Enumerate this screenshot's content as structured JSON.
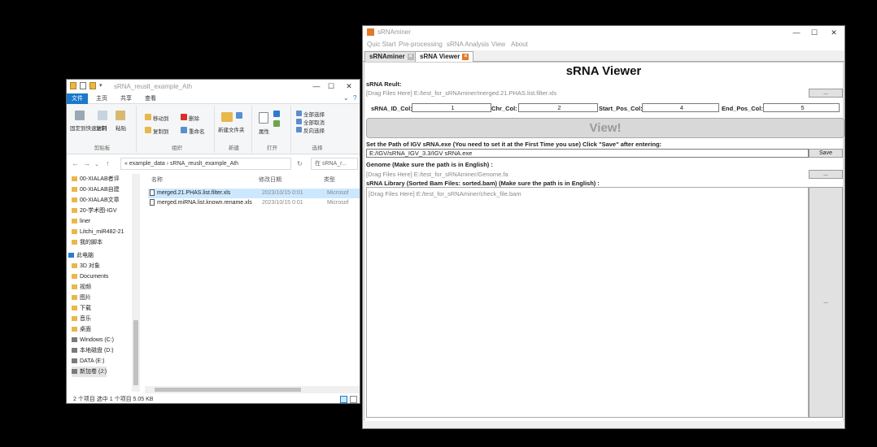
{
  "explorer": {
    "title": "sRNA_reuslt_example_Ath",
    "tabs": [
      "文件",
      "主页",
      "共享",
      "查看"
    ],
    "ribbon": {
      "groups": [
        {
          "label": "剪贴板",
          "items": [
            "固定到快速访问",
            "复制",
            "粘贴"
          ]
        },
        {
          "label": "组织",
          "items": [
            "移动到",
            "删除",
            "复制到",
            "重命名"
          ]
        },
        {
          "label": "新建",
          "items": [
            "新建文件夹"
          ]
        },
        {
          "label": "打开",
          "items": [
            "属性"
          ]
        },
        {
          "label": "选择",
          "items": [
            "全部选择",
            "全部取消",
            "反向选择"
          ]
        }
      ]
    },
    "address": "« example_data › sRNA_reuslt_example_Ath",
    "search_placeholder": "在 sRNA_r...",
    "nav_items": [
      {
        "label": "00-XIALAB者评",
        "type": "folder"
      },
      {
        "label": "00-XIALAB自建",
        "type": "folder"
      },
      {
        "label": "00-XIALAB文章",
        "type": "folder"
      },
      {
        "label": "20-学术图-IGV",
        "type": "folder"
      },
      {
        "label": "liner",
        "type": "folder"
      },
      {
        "label": "Litchi_miR482-21",
        "type": "folder"
      },
      {
        "label": "我的脚本",
        "type": "folder"
      },
      {
        "label": "此电脑",
        "type": "pc"
      },
      {
        "label": "3D 对象",
        "type": "folder"
      },
      {
        "label": "Documents",
        "type": "folder"
      },
      {
        "label": "视频",
        "type": "folder"
      },
      {
        "label": "图片",
        "type": "folder"
      },
      {
        "label": "下载",
        "type": "folder"
      },
      {
        "label": "音乐",
        "type": "folder"
      },
      {
        "label": "桌面",
        "type": "folder"
      },
      {
        "label": "Windows (C:)",
        "type": "drive"
      },
      {
        "label": "本地磁盘 (D:)",
        "type": "drive"
      },
      {
        "label": "DATA (E:)",
        "type": "drive"
      },
      {
        "label": "新加卷 (J:)",
        "type": "drive"
      }
    ],
    "columns": [
      "名称",
      "修改日期",
      "类型"
    ],
    "files": [
      {
        "name": "merged.21.PHAS.list.filter.xls",
        "date": "2023/10/15 0:01",
        "type": "Microsof"
      },
      {
        "name": "merged.miRNA.list.known.rename.xls",
        "date": "2023/10/15 0:01",
        "type": "Microsof"
      }
    ],
    "status": "2 个项目    选中 1 个项目  5.05 KB"
  },
  "srna": {
    "title": "sRNAminer",
    "menu": [
      "Quic Start",
      "Pre-processing",
      "sRNA Analysis",
      "View",
      "About"
    ],
    "tabs": [
      "sRNAminer",
      "sRNA Viewer"
    ],
    "heading": "sRNA Viewer",
    "result_label": "sRNA Reult:",
    "result_path": "[Drag Files Here] E:/test_for_sRNAminer/merged.21.PHAS.list.filter.xls",
    "browse": "...",
    "cols": [
      {
        "label": "sRNA_ID_Col:",
        "value": "1"
      },
      {
        "label": "Chr_Col:",
        "value": "2"
      },
      {
        "label": "Start_Pos_Col:",
        "value": "4"
      },
      {
        "label": "End_Pos_Col:",
        "value": "5"
      }
    ],
    "view_button": "View!",
    "igv_label": "Set the Path of IGV sRNA.exe (You need to set it at the First Time you use) Click \"Save\" after entering:",
    "igv_path": "E:/IGV/sRNA_IGV_3.3/IGV sRNA.exe",
    "save": "Save",
    "genome_label": "Genome (Make sure the path is in English) :",
    "genome_path": "[Drag Files Here] E:/test_for_sRNAminer/Genome.fa",
    "library_label": "sRNA Library (Sorted Bam Files: sorted.bam) (Make sure the path is in English) :",
    "library_path": "[Drag Files Here] E:/test_for_sRNAminer/check_file.bam"
  }
}
